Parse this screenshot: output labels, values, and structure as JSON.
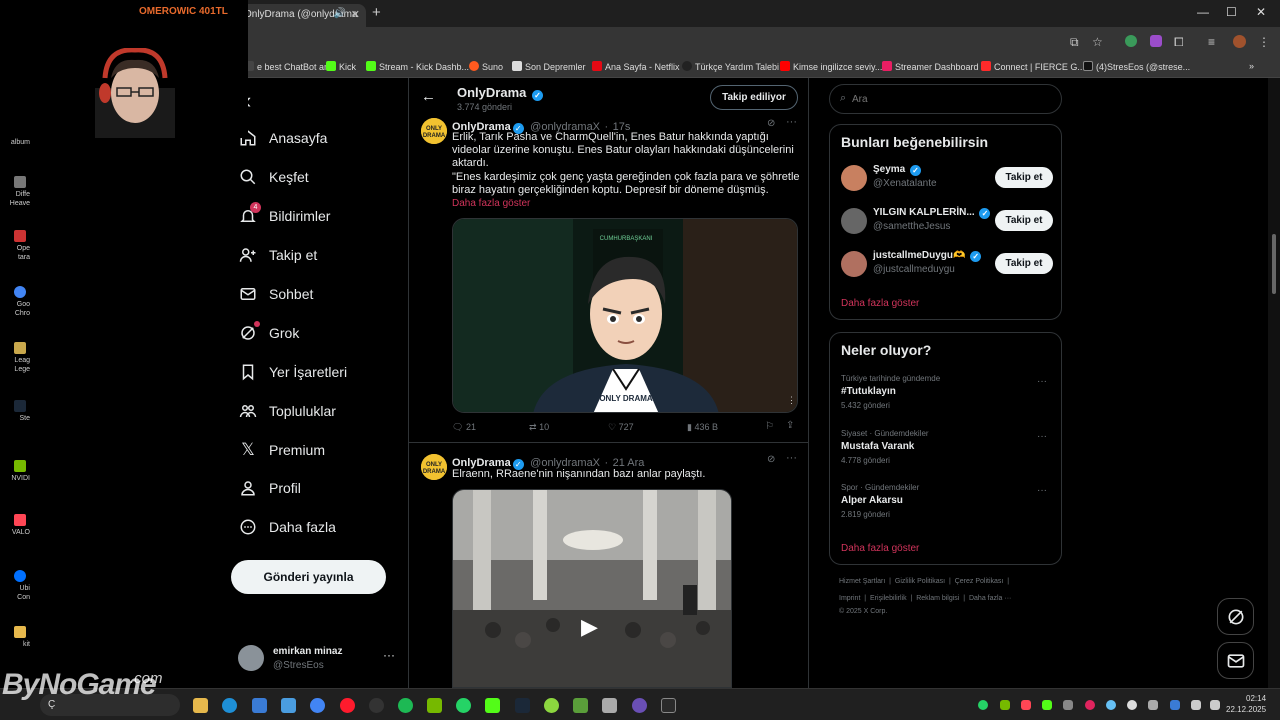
{
  "browser": {
    "tab_title": "OnlyDrama (@onlydrama",
    "bookmarks": [
      {
        "label": "e best ChatBot an...",
        "color": "#444"
      },
      {
        "label": "Kick",
        "color": "#53fc18"
      },
      {
        "label": "Stream - Kick Dashb...",
        "color": "#53fc18"
      },
      {
        "label": "Suno",
        "color": "#ff5a1f"
      },
      {
        "label": "Son Depremler",
        "color": "#dddddd"
      },
      {
        "label": "Ana Sayfa - Netflix",
        "color": "#e50914"
      },
      {
        "label": "Türkçe Yardım Talebi",
        "color": "#222"
      },
      {
        "label": "Kimse ingilizce seviy...",
        "color": "#ff0000"
      },
      {
        "label": "Streamer Dashboard",
        "color": "#e91e63"
      },
      {
        "label": "Connect | FIERCE G...",
        "color": "#ff2a2a"
      },
      {
        "label": "(4)StresEos (@strese...",
        "color": "#111"
      }
    ]
  },
  "overlay": {
    "streamer": "OMEROWIC 401TL",
    "watermark": "ByNoGame",
    "watermark_suffix": ".com"
  },
  "desktop": [
    {
      "label": "album",
      "color": "#666"
    },
    {
      "label": "Diffe\nHeave",
      "color": "#777"
    },
    {
      "label": "Ope\ntara",
      "color": "#c33"
    },
    {
      "label": "Goo\nChro",
      "color": "#4285f4"
    },
    {
      "label": "Leag\nLege",
      "color": "#c9a84c"
    },
    {
      "label": "Ste",
      "color": "#1b2838"
    },
    {
      "label": "NVIDI",
      "color": "#76b900"
    },
    {
      "label": "VALO",
      "color": "#ff4655"
    },
    {
      "label": "Ubi\nCon",
      "color": "#0070ff"
    },
    {
      "label": "kit",
      "color": "#e6b84c"
    }
  ],
  "nav": {
    "items": [
      {
        "label": "Anasayfa",
        "icon": "home-icon"
      },
      {
        "label": "Keşfet",
        "icon": "search-icon"
      },
      {
        "label": "Bildirimler",
        "icon": "bell-icon",
        "badge": "4"
      },
      {
        "label": "Takip et",
        "icon": "follow-icon"
      },
      {
        "label": "Sohbet",
        "icon": "mail-icon"
      },
      {
        "label": "Grok",
        "icon": "grok-icon"
      },
      {
        "label": "Yer İşaretleri",
        "icon": "bookmark-icon"
      },
      {
        "label": "Topluluklar",
        "icon": "communities-icon"
      },
      {
        "label": "Premium",
        "icon": "x-icon"
      },
      {
        "label": "Profil",
        "icon": "profile-icon"
      },
      {
        "label": "Daha fazla",
        "icon": "more-icon"
      }
    ],
    "post_button": "Gönderi yayınla",
    "account": {
      "name": "emirkan minaz",
      "handle": "@StresEos"
    }
  },
  "profile_header": {
    "name": "OnlyDrama",
    "posts": "3.774 gönderi",
    "follow_state": "Takip ediliyor"
  },
  "tweets": [
    {
      "name": "OnlyDrama",
      "handle": "@onlydramaX",
      "time": "17s",
      "text1": "Erlik, Tarık Pasha ve CharmQuell'in, Enes Batur hakkında yaptığı videolar üzerine konuştu. Enes Batur olayları hakkındaki düşüncelerini aktardı.",
      "text2": "\"Enes kardeşimiz çok genç yaşta gereğinden çok fazla para ve şöhretle biraz hayatın gerçekliğinden koptu. Depresif bir döneme düşmüş.",
      "show_more": "Daha fazla göster",
      "replies": "21",
      "retweets": "10",
      "likes": "727",
      "views": "436 B",
      "media_caption": "CUMHURBAŞKANI",
      "media_logo": "ONLY DRAMA"
    },
    {
      "name": "OnlyDrama",
      "handle": "@onlydramaX",
      "time": "21 Ara",
      "text1": "Elraenn, RRaene'nin nişanından bazı anlar paylaştı."
    }
  ],
  "search": {
    "placeholder": "Ara"
  },
  "who_to_follow": {
    "title": "Bunları beğenebilirsin",
    "button": "Takip et",
    "users": [
      {
        "name": "Şeyma",
        "handle": "@Xenatalante",
        "color": "#c88060"
      },
      {
        "name": "YILGIN KALPLERİN...",
        "handle": "@samettheJesus",
        "color": "#666"
      },
      {
        "name": "justcallmeDuygu🫶",
        "handle": "@justcallmeduygu",
        "color": "#b07060"
      }
    ],
    "show_more": "Daha fazla göster"
  },
  "trends": {
    "title": "Neler oluyor?",
    "items": [
      {
        "context": "Türkiye tarihinde gündemde",
        "topic": "#Tutuklayın",
        "count": "5.432 gönderi"
      },
      {
        "context": "Siyaset · Gündemdekiler",
        "topic": "Mustafa Varank",
        "count": "4.778 gönderi"
      },
      {
        "context": "Spor · Gündemdekiler",
        "topic": "Alper Akarsu",
        "count": "2.819 gönderi"
      }
    ],
    "show_more": "Daha fazla göster"
  },
  "footer": {
    "line1": [
      "Hizmet Şartları",
      "Gizlilik Politikası",
      "Çerez Politikası"
    ],
    "line2": [
      "Imprint",
      "Erişilebilirlik",
      "Reklam bilgisi",
      "Daha fazla ···"
    ],
    "copyright": "© 2025 X Corp."
  },
  "taskbar": {
    "search_text": "Ç",
    "time": "02:14",
    "date": "22.12.2025"
  }
}
